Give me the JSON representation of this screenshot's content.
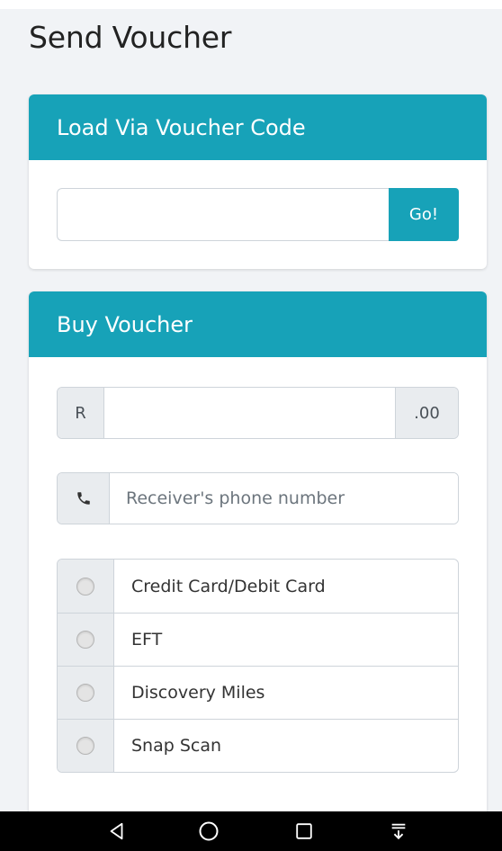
{
  "page": {
    "title": "Send Voucher"
  },
  "voucher_code_card": {
    "header": "Load Via Voucher Code",
    "input_value": "",
    "input_placeholder": "",
    "go_label": "Go!"
  },
  "buy_card": {
    "header": "Buy Voucher",
    "amount": {
      "prefix": "R",
      "value": "",
      "suffix": ".00"
    },
    "phone": {
      "icon": "phone-icon",
      "placeholder": "Receiver's phone number",
      "value": ""
    },
    "payment_methods": [
      {
        "label": "Credit Card/Debit Card",
        "selected": false
      },
      {
        "label": "EFT",
        "selected": false
      },
      {
        "label": "Discovery Miles",
        "selected": false
      },
      {
        "label": "Snap Scan",
        "selected": false
      }
    ]
  },
  "nav_bar": {
    "icons": [
      "back-icon",
      "home-icon",
      "recents-icon",
      "notification-drawer-icon"
    ]
  },
  "colors": {
    "accent": "#17a2b8",
    "background": "#f1f3f6",
    "addon": "#e9ecef",
    "border": "#ced4da",
    "nav": "#000000"
  }
}
